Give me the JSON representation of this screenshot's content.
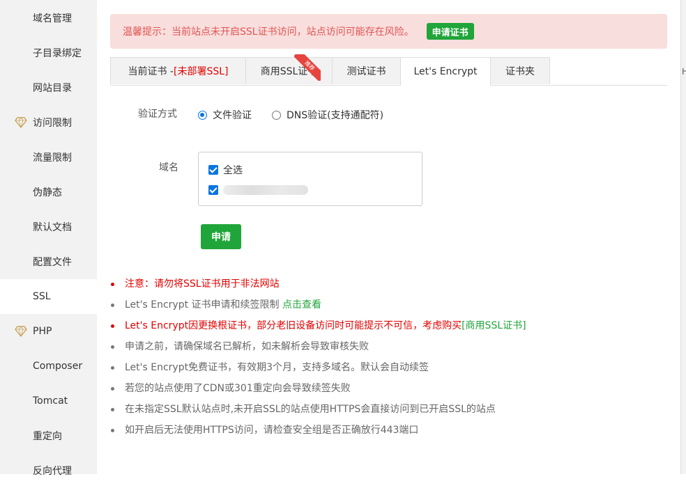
{
  "sidebar": {
    "items": [
      {
        "label": "域名管理",
        "icon": "",
        "active": false
      },
      {
        "label": "子目录绑定",
        "icon": "",
        "active": false
      },
      {
        "label": "网站目录",
        "icon": "",
        "active": false
      },
      {
        "label": "访问限制",
        "icon": "vip-diamond-icon",
        "active": false
      },
      {
        "label": "流量限制",
        "icon": "",
        "active": false
      },
      {
        "label": "伪静态",
        "icon": "",
        "active": false
      },
      {
        "label": "默认文档",
        "icon": "",
        "active": false
      },
      {
        "label": "配置文件",
        "icon": "",
        "active": false
      },
      {
        "label": "SSL",
        "icon": "",
        "active": true
      },
      {
        "label": "PHP",
        "icon": "vip-diamond-icon",
        "active": false
      },
      {
        "label": "Composer",
        "icon": "",
        "active": false
      },
      {
        "label": "Tomcat",
        "icon": "",
        "active": false
      },
      {
        "label": "重定向",
        "icon": "",
        "active": false
      },
      {
        "label": "反向代理",
        "icon": "",
        "active": false
      }
    ]
  },
  "alert": {
    "text": "温馨提示：当前站点未开启SSL证书访问，站点访问可能存在风险。",
    "button": "申请证书"
  },
  "tabs": [
    {
      "label": "当前证书 - ",
      "suffix": "[未部署SSL]"
    },
    {
      "label": "商用SSL证书",
      "badge": "推荐"
    },
    {
      "label": "测试证书"
    },
    {
      "label": "Let's Encrypt",
      "active": true
    },
    {
      "label": "证书夹"
    }
  ],
  "form": {
    "verify_label": "验证方式",
    "verify_options": [
      {
        "label": "文件验证",
        "checked": true
      },
      {
        "label": "DNS验证(支持通配符)",
        "checked": false
      }
    ],
    "domain_label": "域名",
    "domain_items": [
      {
        "label": "全选",
        "checked": true
      },
      {
        "label": "",
        "checked": true,
        "redacted": true
      }
    ],
    "submit": "申请"
  },
  "notes": [
    {
      "text": "注意：请勿将SSL证书用于非法网站",
      "warn": true
    },
    {
      "text": "Let's Encrypt 证书申请和续签限制 ",
      "link": "点击查看",
      "warn": false
    },
    {
      "text": "Let's Encrypt因更换根证书，部分老旧设备访问时可能提示不可信，考虑购买",
      "link": "[商用SSL证书]",
      "warn": true
    },
    {
      "text": "申请之前，请确保域名已解析，如未解析会导致审核失败",
      "warn": false
    },
    {
      "text": "Let's Encrypt免费证书，有效期3个月，支持多域名。默认会自动续签",
      "warn": false
    },
    {
      "text": "若您的站点使用了CDN或301重定向会导致续签失败",
      "warn": false
    },
    {
      "text": "在未指定SSL默认站点时,未开启SSL的站点使用HTTPS会直接访问到已开启SSL的站点",
      "warn": false
    },
    {
      "text": "如开启后无法使用HTTPS访问，请检查安全组是否正确放行443端口",
      "warn": false
    }
  ],
  "colors": {
    "accent_green": "#20a53a",
    "warning_red": "#e20000",
    "alert_bg": "#f8dedd"
  }
}
